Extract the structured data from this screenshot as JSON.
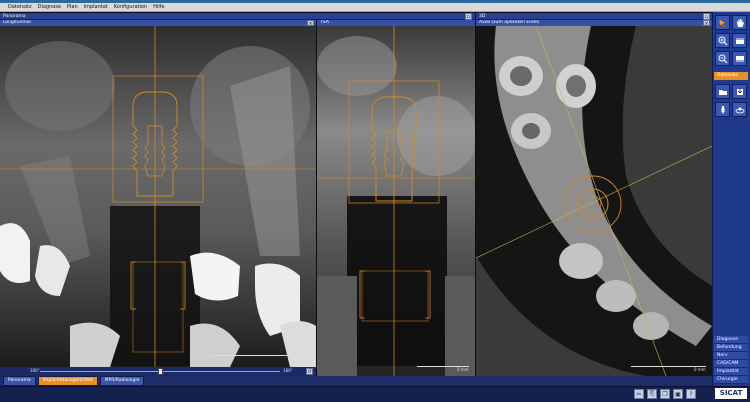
{
  "menu": {
    "items": [
      "Dateisatz",
      "Diagnose",
      "Plan",
      "Implantat",
      "Konfiguration",
      "Hilfe"
    ]
  },
  "viewports": {
    "panorama": {
      "header": "Panorama",
      "subheader": "Longitudinal",
      "scale": "1 cm"
    },
    "tsa": {
      "header": "",
      "subheader": "TSA",
      "scale": "0 mm"
    },
    "view3d": {
      "header": "3D",
      "subheader": "Axial (zum aplikaten Ende)",
      "scale": "0 mm"
    }
  },
  "slider": {
    "left_label": "180°",
    "right_label": "180°",
    "position_fraction": 0.5
  },
  "bottom_tabs": [
    {
      "label": "Panorama",
      "active": false
    },
    {
      "label": "Implantatausgerichtet",
      "active": true
    },
    {
      "label": "MPR/Radiologie",
      "active": false
    }
  ],
  "toolbar": {
    "tools": [
      "cursor-arrow",
      "hand-pan",
      "zoom-in",
      "zoom-out",
      "view-layout-1",
      "view-layout-2"
    ],
    "dateisatz_label": "Dateisatz"
  },
  "sidenav": {
    "items": [
      "Diagnose",
      "Befundung",
      "Nerv",
      "CAD/CAM",
      "Implantat",
      "Chirurgie"
    ]
  },
  "brand": {
    "logo": "SICAT"
  },
  "colors": {
    "accent": "#e5902a",
    "panel": "#2a3f92",
    "guide": "#d48a22"
  }
}
